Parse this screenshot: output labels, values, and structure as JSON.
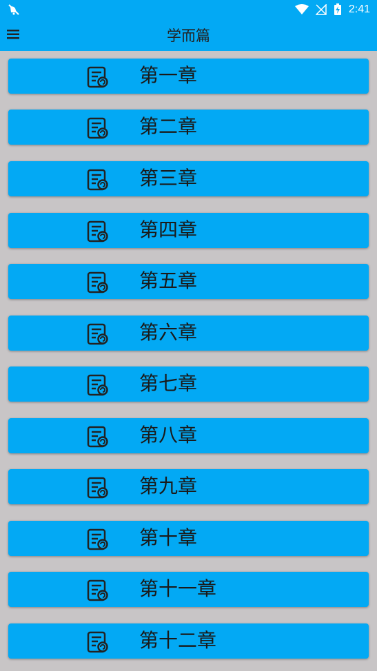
{
  "status_bar": {
    "time": "2:41",
    "icons": [
      "notification-icon",
      "wifi-icon",
      "signal-off-icon",
      "battery-charging-icon"
    ]
  },
  "app_bar": {
    "title": "学而篇",
    "menu_icon": "menu-icon"
  },
  "chapters": [
    {
      "label": "第一章"
    },
    {
      "label": "第二章"
    },
    {
      "label": "第三章"
    },
    {
      "label": "第四章"
    },
    {
      "label": "第五章"
    },
    {
      "label": "第六章"
    },
    {
      "label": "第七章"
    },
    {
      "label": "第八章"
    },
    {
      "label": "第九章"
    },
    {
      "label": "第十章"
    },
    {
      "label": "第十一章"
    },
    {
      "label": "第十二章"
    }
  ],
  "colors": {
    "accent": "#03a9f4",
    "background": "#c8c5c6",
    "text": "#1a1a1a"
  }
}
